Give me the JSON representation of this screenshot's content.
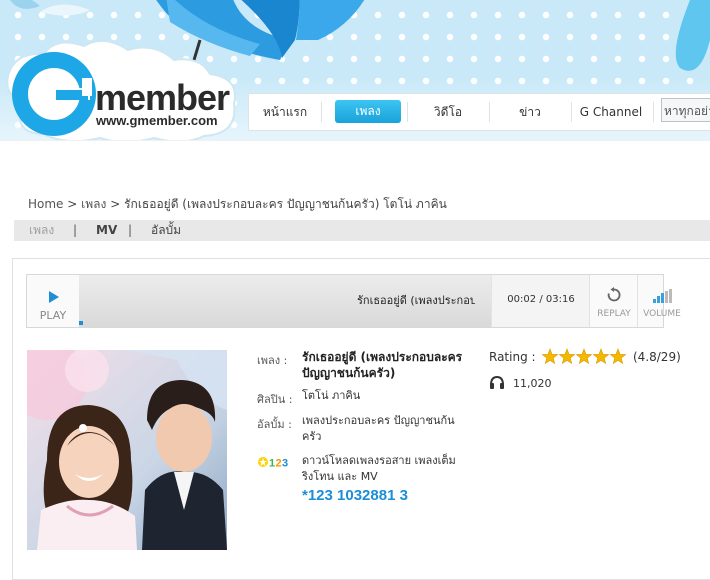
{
  "site": {
    "logo_text": "member",
    "logo_url": "www.gmember.com",
    "brand_color": "#1aa2da"
  },
  "nav": {
    "items": [
      {
        "label": "หน้าแรก",
        "active": false
      },
      {
        "label": "เพลง",
        "active": true
      },
      {
        "label": "วิดีโอ",
        "active": false
      },
      {
        "label": "ข่าว",
        "active": false
      },
      {
        "label": "G Channel",
        "active": false
      }
    ],
    "search_placeholder": "หาทุกอย่าง"
  },
  "breadcrumb": {
    "home": "Home",
    "sep1": ">",
    "section": "เพลง",
    "sep2": ">",
    "current": "รักเธออยู่ดี (เพลงประกอบละคร ปัญญาชนก้นครัว) โตโน่ ภาคิน"
  },
  "subnav": {
    "items": [
      {
        "label": "เพลง",
        "active": true
      },
      {
        "label": "MV",
        "active": false
      },
      {
        "label": "อัลบั้ม",
        "active": false
      }
    ],
    "separator": "|"
  },
  "player": {
    "play_label": "PLAY",
    "track_title": "รักเธออยู่ดี (เพลงประกอบ",
    "time_current": "00:02",
    "time_separator": "/",
    "time_total": "03:16",
    "progress": 0.01,
    "replay_label": "REPLAY",
    "volume_label": "VOLUME"
  },
  "song": {
    "song_label": "เพลง :",
    "title": "รักเธออยู่ดี (เพลงประกอบละคร ปัญญาชนก้นครัว)",
    "artist_label": "ศิลปิน :",
    "artist": "โตโน่ ภาคิน",
    "album_label": "อัลบั้ม :",
    "album": "เพลงประกอบละคร ปัญญาชนก้นครัว",
    "download_text": "ดาวน์โหลดเพลงรอสาย เพลงเต็ม ริงโทน และ MV",
    "code": "*123 1032881 3",
    "rating_label": "Rating :",
    "rating_value": 4.8,
    "rating_text": "(4.8/29)",
    "stars": 5,
    "plays": "11,020",
    "star_color": "#f5b800"
  }
}
